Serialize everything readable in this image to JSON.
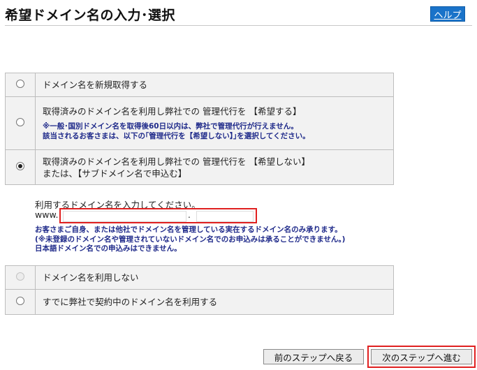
{
  "header": {
    "title": "希望ドメイン名の入力･選択",
    "help_label": "ヘルプ"
  },
  "options_top": [
    {
      "label": "ドメイン名を新規取得する",
      "selected": false,
      "disabled": false
    },
    {
      "label": "取得済みのドメイン名を利用し弊社での 管理代行を 【希望する】",
      "note_line1": "※一般･国別ドメイン名を取得後60日以内は、弊社で管理代行が行えません。",
      "note_line2": "該当されるお客さまは、以下の｢管理代行を【希望しない】｣を選択してください。",
      "selected": false,
      "disabled": false
    },
    {
      "label_line1": "取得済みのドメイン名を利用し弊社での 管理代行を 【希望しない】",
      "label_line2": "または、【サブドメイン名で申込む】",
      "selected": true,
      "disabled": false
    }
  ],
  "domain_entry": {
    "prompt": "利用するドメイン名を入力してください。",
    "prefix": "www.",
    "dot": ".",
    "name_value": "",
    "tld_value": "",
    "note_line1": "お客さまご自身、または他社でドメイン名を管理している実在するドメイン名のみ承ります。",
    "note_line2": "(※未登録のドメイン名や管理されていないドメイン名でのお申込みは承ることができません。)",
    "note_line3": "日本語ドメイン名での申込みはできません。"
  },
  "options_bottom": [
    {
      "label": "ドメイン名を利用しない",
      "selected": false,
      "disabled": true
    },
    {
      "label": "すでに弊社で契約中のドメイン名を利用する",
      "selected": false,
      "disabled": false
    }
  ],
  "footer": {
    "back_label": "前のステップへ戻る",
    "next_label": "次のステップへ進む"
  },
  "colors": {
    "help_bg": "#1a73c9",
    "highlight_border": "#e02020",
    "note_text": "#1f2a8a",
    "row_bg": "#f2f2f2"
  }
}
